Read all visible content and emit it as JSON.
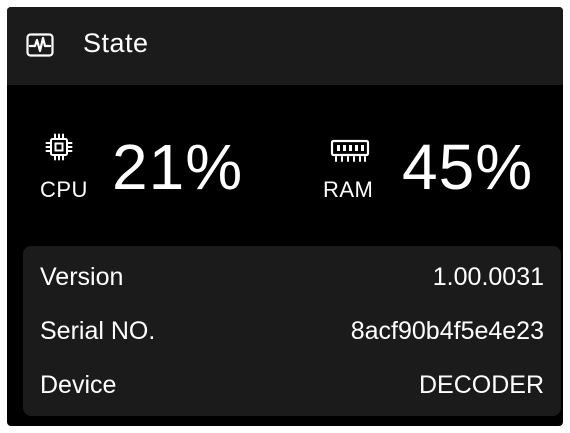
{
  "header": {
    "title": "State",
    "icon": "activity-monitor-icon"
  },
  "metrics": {
    "cpu": {
      "label": "CPU",
      "value": "21%",
      "icon": "cpu-chip-icon"
    },
    "ram": {
      "label": "RAM",
      "value": "45%",
      "icon": "memory-stick-icon"
    }
  },
  "info": {
    "rows": [
      {
        "key": "Version",
        "value": "1.00.0031"
      },
      {
        "key": "Serial NO.",
        "value": "8acf90b4f5e4e23"
      },
      {
        "key": "Device",
        "value": "DECODER"
      }
    ]
  },
  "colors": {
    "panel": "#000000",
    "header": "#1b1b1b",
    "card": "#1b1b1b",
    "text": "#ffffff"
  }
}
